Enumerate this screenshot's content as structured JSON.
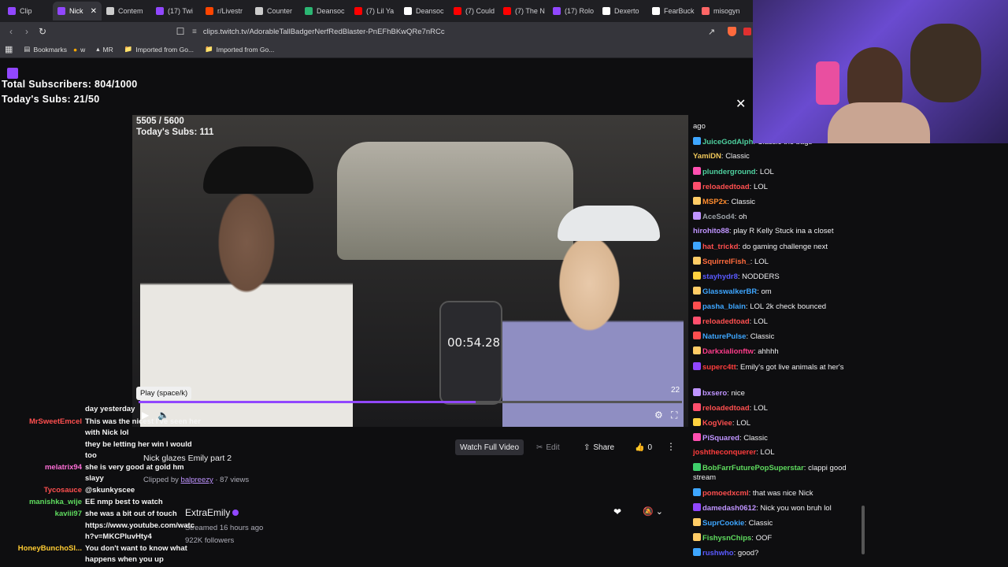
{
  "browser": {
    "tabs": [
      {
        "label": "Clip",
        "color": "#9147ff"
      },
      {
        "label": "Nick",
        "color": "#9147ff",
        "active": true
      },
      {
        "label": "Contem",
        "color": "#cccccc"
      },
      {
        "label": "(17) Twi",
        "color": "#9147ff"
      },
      {
        "label": "r/Livestr",
        "color": "#ff4500"
      },
      {
        "label": "Counter",
        "color": "#cccccc"
      },
      {
        "label": "Deansoc",
        "color": "#2bb673"
      },
      {
        "label": "(7) Lil Ya",
        "color": "#ff0000"
      },
      {
        "label": "Deansoc",
        "color": "#ffffff"
      },
      {
        "label": "(7) Could",
        "color": "#ff0000"
      },
      {
        "label": "(7) The N",
        "color": "#ff0000"
      },
      {
        "label": "(17) Rolo",
        "color": "#9147ff"
      },
      {
        "label": "Dexerto",
        "color": "#ffffff"
      },
      {
        "label": "FearBuck",
        "color": "#ffffff"
      },
      {
        "label": "misogyn",
        "color": "#ff6666"
      }
    ],
    "url": "clips.twitch.tv/AdorableTallBadgerNerfRedBlaster-PnEFhBKwQRe7nRCc",
    "bookmarks": [
      "Bookmarks",
      "w",
      "MR",
      "Imported from Go...",
      "Imported from Go..."
    ]
  },
  "overlay": {
    "total_subs": "Total Subscribers: 804/1000",
    "today_subs": "Today's Subs: 21/50"
  },
  "video": {
    "count": "5505 / 5600",
    "today_subs": "Today's Subs: 111",
    "phone_time": "00:54.28",
    "tooltip": "Play (space/k)",
    "progress": 0.62,
    "badge_num": "22"
  },
  "clip": {
    "title": "Nick glazes Emily part 2",
    "clipped_by_prefix": "Clipped by",
    "clipper": "balpreezy",
    "views": "· 87 views",
    "watch_full": "Watch Full Video",
    "edit": "Edit",
    "share": "Share",
    "likes": "0",
    "channel": "ExtraEmily",
    "streamed": "Streamed 16 hours ago",
    "followers": "922K followers"
  },
  "left_chat": [
    {
      "name": "",
      "text": "day yesterday",
      "color": "#f5f5f5"
    },
    {
      "name": "MrSweetEmcel",
      "text": "This was the nicest I've seen her",
      "color": "#ff4f4f"
    },
    {
      "name": "",
      "text": "with Nick lol",
      "color": "#f5f5f5"
    },
    {
      "name": "",
      "text": "they be letting her win I would",
      "color": "#f5f5f5"
    },
    {
      "name": "",
      "text": "too",
      "color": "#f5f5f5"
    },
    {
      "name": "melatrix94",
      "text": "she is very good at gold hm",
      "color": "#ff6fd8"
    },
    {
      "name": "",
      "text": "slayy",
      "color": "#f5f5f5"
    },
    {
      "name": "Tycosauce",
      "text": "@skunkyscee",
      "color": "#ff4f4f"
    },
    {
      "name": "manishka_wije",
      "text": "EE nmp best to watch",
      "color": "#5fdc5f"
    },
    {
      "name": "kaviii97",
      "text": "she was a bit out of touch",
      "color": "#5fdc5f"
    },
    {
      "name": "",
      "text": "https://www.youtube.com/watc",
      "color": "#f5f5f5"
    },
    {
      "name": "",
      "text": "h?v=MKCPluvHty4",
      "color": "#f5f5f5"
    },
    {
      "name": "HoneyBunchoSl...",
      "text": "You don't want to know what",
      "color": "#ffcc33"
    },
    {
      "name": "",
      "text": "happens when you up",
      "color": "#f5f5f5"
    }
  ],
  "right_chat": [
    {
      "name": "",
      "text": "ago",
      "color": "#efeff1",
      "badge": ""
    },
    {
      "name": "JuiceGodAlph",
      "text": "Classic the bags",
      "color": "#4ecf9e",
      "badge": "#3ea6ff"
    },
    {
      "name": "YamiDN",
      "text": "Classic",
      "color": "#f0c85a",
      "badge": ""
    },
    {
      "name": "plunderground",
      "text": "LOL",
      "color": "#4ecf9e",
      "badge": "#ff4fb0"
    },
    {
      "name": "reloadedtoad",
      "text": "LOL",
      "color": "#ff5050",
      "badge": "#ff4f6d"
    },
    {
      "name": "MSP2x",
      "text": "Classic",
      "color": "#ff8c2e",
      "badge": "#ffcc66"
    },
    {
      "name": "AceSod4",
      "text": "oh",
      "color": "#9aa0a6",
      "badge": "#bf94ff"
    },
    {
      "name": "hirohito88",
      "text": "play R Kelly Stuck ina a closet",
      "color": "#bf94ff",
      "badge": ""
    },
    {
      "name": "hat_trickd",
      "text": "do gaming challenge next",
      "color": "#ff4f4f",
      "badge": "#3ea6ff"
    },
    {
      "name": "SquirrelFish_",
      "text": "LOL",
      "color": "#ff6b3d",
      "badge": "#ffcc66"
    },
    {
      "name": "stayhydr8",
      "text": "NODDERS",
      "color": "#5a5aff",
      "badge": "#ffd23f"
    },
    {
      "name": "GlasswalkerBR",
      "text": "om",
      "color": "#3ea6ff",
      "badge": "#ffcc66"
    },
    {
      "name": "pasha_blain",
      "text": "LOL 2k check bounced",
      "color": "#3ea6ff",
      "badge": "#ff4f4f"
    },
    {
      "name": "reloadedtoad",
      "text": "LOL",
      "color": "#ff5050",
      "badge": "#ff4f6d"
    },
    {
      "name": "NaturePulse",
      "text": "Classic",
      "color": "#3ea6ff",
      "badge": "#ff4f4f"
    },
    {
      "name": "Darkxialionftw",
      "text": "ahhhh",
      "color": "#ff3d8b",
      "badge": "#ffcc66"
    },
    {
      "name": "superc4tt",
      "text": "Emily's got live animals at her's",
      "color": "#ff3d3d",
      "badge": "#9147ff"
    },
    {
      "name": "bxsero",
      "text": "nice",
      "color": "#bf94ff",
      "badge": "#bf94ff"
    },
    {
      "name": "reloadedtoad",
      "text": "LOL",
      "color": "#ff5050",
      "badge": "#ff4f6d"
    },
    {
      "name": "KogViee",
      "text": "LOL",
      "color": "#ff4f4f",
      "badge": "#ffd23f"
    },
    {
      "name": "PiSquared",
      "text": "Classic",
      "color": "#bf94ff",
      "badge": "#ff4fb0"
    },
    {
      "name": "joshtheconquerer",
      "text": "LOL",
      "color": "#ff3d3d",
      "badge": ""
    },
    {
      "name": "BobFarrFuturePopSuperstar",
      "text": "clappi good stream",
      "color": "#5fdc5f",
      "badge": "#3ecf6b"
    },
    {
      "name": "pomoedxcml",
      "text": "that was nice Nick",
      "color": "#ff4f4f",
      "badge": "#3ea6ff"
    },
    {
      "name": "damedash0612",
      "text": "Nick you won bruh lol",
      "color": "#bf94ff",
      "badge": "#9147ff"
    },
    {
      "name": "SuprCookie",
      "text": "Classic",
      "color": "#3ea6ff",
      "badge": "#ffcc66"
    },
    {
      "name": "FishysnChips",
      "text": "OOF",
      "color": "#5fdc5f",
      "badge": "#ffcc66"
    },
    {
      "name": "rushwho",
      "text": "good?",
      "color": "#5a5aff",
      "badge": "#3ea6ff"
    }
  ]
}
